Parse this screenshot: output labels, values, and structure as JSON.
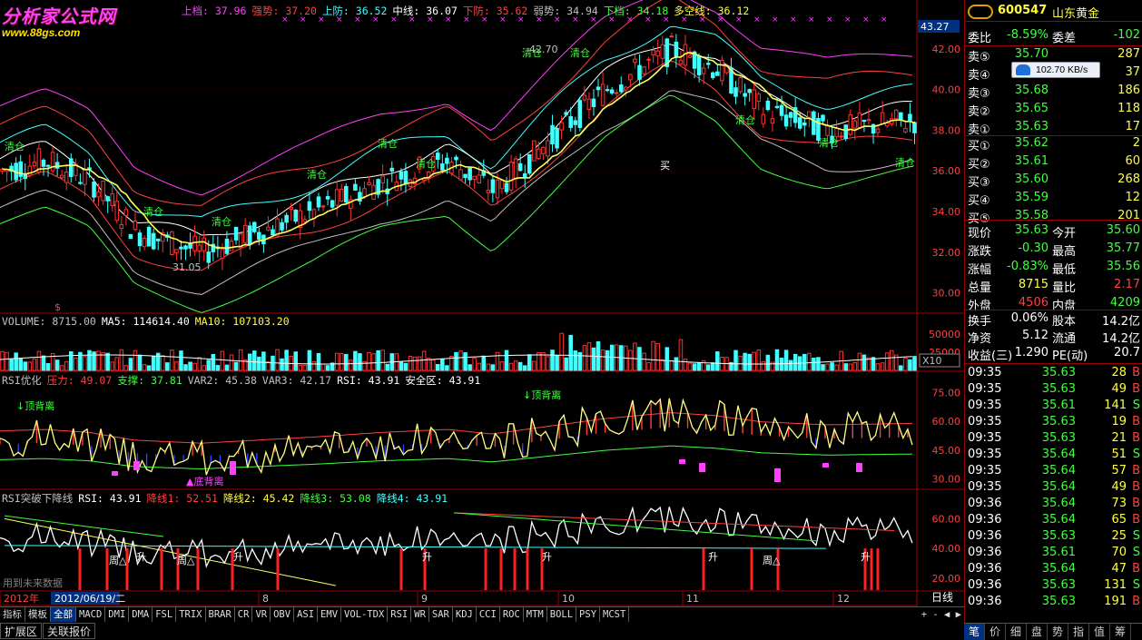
{
  "watermark": {
    "title": "分析家公式网",
    "url": "www.88gs.com"
  },
  "main_header": [
    {
      "t": "上档: 37.96",
      "c": "#ff40ff"
    },
    {
      "t": "强势: 37.20",
      "c": "#ff4040"
    },
    {
      "t": "上防: 36.52",
      "c": "#40ffff"
    },
    {
      "t": "中线: 36.07",
      "c": "#ffffff"
    },
    {
      "t": "下防: 35.62",
      "c": "#ff4040"
    },
    {
      "t": "弱势: 34.94",
      "c": "#c0c0c0"
    },
    {
      "t": "下档: 34.18",
      "c": "#40ff40"
    },
    {
      "t": "多空线: 36.12",
      "c": "#ffff40"
    }
  ],
  "vol_header": {
    "a": "VOLUME: 8715.00",
    "b": "MA5: 114614.40",
    "c": "MA10: 107103.20"
  },
  "rsi_header": [
    {
      "t": "RSI优化",
      "c": "#c0c0c0"
    },
    {
      "t": "压力: 49.07",
      "c": "#ff4040"
    },
    {
      "t": "支撑: 37.81",
      "c": "#40ff40"
    },
    {
      "t": "VAR2: 45.38",
      "c": "#c0c0c0"
    },
    {
      "t": "VAR3: 42.17",
      "c": "#c0c0c0"
    },
    {
      "t": "RSI: 43.91",
      "c": "#ffffff"
    },
    {
      "t": "安全区: 43.91",
      "c": "#ffffff"
    }
  ],
  "brk_header": [
    {
      "t": "RSI突破下降线",
      "c": "#c0c0c0"
    },
    {
      "t": "RSI: 43.91",
      "c": "#ffffff"
    },
    {
      "t": "降线1: 52.51",
      "c": "#ff4040"
    },
    {
      "t": "降线2: 45.42",
      "c": "#ffff40"
    },
    {
      "t": "降线3: 53.08",
      "c": "#40ff40"
    },
    {
      "t": "降线4: 43.91",
      "c": "#40ffff"
    }
  ],
  "labels": {
    "qing": "清仓",
    "mai": "买",
    "zhou": "周△",
    "sheng": "升",
    "top_div": "↓顶背离",
    "bottom_div": "▲底背离",
    "future": "用到未来数据",
    "low": "31.05",
    "high": "42.70",
    "price_cur": "43.27",
    "x10": "X10",
    "daily": "日线",
    "year": "2012年",
    "date": "2012/06/19/二"
  },
  "price_axis": [
    "42.00",
    "40.00",
    "38.00",
    "36.00",
    "34.00",
    "32.00",
    "30.00"
  ],
  "vol_axis": [
    "50000",
    "25000"
  ],
  "rsi_axis": [
    "75.00",
    "60.00",
    "45.00",
    "30.00"
  ],
  "brk_axis": [
    "60.00",
    "40.00",
    "20.00"
  ],
  "months": [
    "8",
    "9",
    "10",
    "11",
    "12"
  ],
  "quote": {
    "code": "600547",
    "name": "山东黄金",
    "weibi": {
      "l1": "委比",
      "v1": "-8.59%",
      "l2": "委差",
      "v2": "-102"
    },
    "sell": [
      [
        "卖⑤",
        "35.70",
        "287"
      ],
      [
        "卖④",
        "35.69",
        "37"
      ],
      [
        "卖③",
        "35.68",
        "186"
      ],
      [
        "卖②",
        "35.65",
        "118"
      ],
      [
        "卖①",
        "35.63",
        "17"
      ]
    ],
    "buy": [
      [
        "买①",
        "35.62",
        "2"
      ],
      [
        "买②",
        "35.61",
        "60"
      ],
      [
        "买③",
        "35.60",
        "268"
      ],
      [
        "买④",
        "35.59",
        "12"
      ],
      [
        "买⑤",
        "35.58",
        "201"
      ]
    ],
    "stats": [
      [
        "现价",
        "35.63",
        "今开",
        "35.60"
      ],
      [
        "涨跌",
        "-0.30",
        "最高",
        "35.77"
      ],
      [
        "涨幅",
        "-0.83%",
        "最低",
        "35.56"
      ],
      [
        "总量",
        "8715",
        "量比",
        "2.17"
      ],
      [
        "外盘",
        "4506",
        "内盘",
        "4209"
      ]
    ],
    "fund": [
      [
        "换手",
        "0.06%",
        "股本",
        "14.2亿"
      ],
      [
        "净资",
        "5.12",
        "流通",
        "14.2亿"
      ],
      [
        "收益(三)",
        "1.290",
        "PE(动)",
        "20.7"
      ]
    ],
    "ticks": [
      [
        "09:35",
        "35.63",
        "28",
        "B"
      ],
      [
        "09:35",
        "35.63",
        "49",
        "B"
      ],
      [
        "09:35",
        "35.61",
        "141",
        "S"
      ],
      [
        "09:35",
        "35.63",
        "19",
        "B"
      ],
      [
        "09:35",
        "35.63",
        "21",
        "B"
      ],
      [
        "09:35",
        "35.64",
        "51",
        "S"
      ],
      [
        "09:35",
        "35.64",
        "57",
        "B"
      ],
      [
        "09:35",
        "35.64",
        "49",
        "B"
      ],
      [
        "09:36",
        "35.64",
        "73",
        "B"
      ],
      [
        "09:36",
        "35.64",
        "65",
        "B"
      ],
      [
        "09:36",
        "35.63",
        "25",
        "S"
      ],
      [
        "09:36",
        "35.61",
        "70",
        "S"
      ],
      [
        "09:36",
        "35.64",
        "47",
        "B"
      ],
      [
        "09:36",
        "35.63",
        "131",
        "S"
      ],
      [
        "09:36",
        "35.63",
        "191",
        "B"
      ]
    ]
  },
  "speed": "102.70 KB/s",
  "tabs1": [
    "指标",
    "模板",
    "全部",
    "MACD",
    "DMI",
    "DMA",
    "FSL",
    "TRIX",
    "BRAR",
    "CR",
    "VR",
    "OBV",
    "ASI",
    "EMV",
    "VOL-TDX",
    "RSI",
    "WR",
    "SAR",
    "KDJ",
    "CCI",
    "ROC",
    "MTM",
    "BOLL",
    "PSY",
    "MCST"
  ],
  "tabs2": [
    "扩展区",
    "关联报价"
  ],
  "rtabs": [
    "笔",
    "价",
    "细",
    "盘",
    "势",
    "指",
    "值",
    "筹"
  ],
  "colors": {
    "up": "#ff3030",
    "down": "#40ffff",
    "ma": "#ffff60"
  }
}
